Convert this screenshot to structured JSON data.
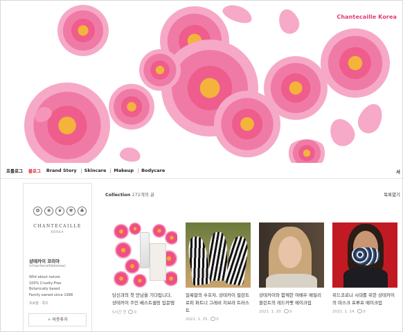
{
  "banner": {
    "brand_title": "Chantecaille Korea"
  },
  "nav": {
    "items": [
      {
        "label": "프롤로그",
        "active": false
      },
      {
        "label": "블로그",
        "active": true
      },
      {
        "label": "Brand Story",
        "active": false
      },
      {
        "label": "Skincare",
        "active": false
      },
      {
        "label": "Makeup",
        "active": false
      },
      {
        "label": "Bodycare",
        "active": false
      }
    ],
    "right_label": "서"
  },
  "profile": {
    "logo_text": "CHANTECAILLE",
    "logo_sub": "KOREA",
    "name": "샹테카이 코리아",
    "id": "(chantecaillekorea)",
    "desc": [
      "Wild about nature",
      "100% Cruelty-Free",
      "Botanically based",
      "Family owned since 1998"
    ],
    "meta": "프로필 · 쪽지",
    "neighbor_button": "이웃추가"
  },
  "collection": {
    "label": "Collection",
    "count": "272개의 글",
    "more": "목록열기"
  },
  "posts": [
    {
      "title": "당신과의 첫 만남을 기다립니다, 샹테카이 주인 베스트셀링 입문템",
      "date": "5시간 전",
      "comments": "0"
    },
    {
      "title": "얼룩말의 수호자, 샹테카이 필란트로피 파트너 그레비 지브라 트러스트",
      "date": "2021. 1. 25.",
      "comments": "0"
    },
    {
      "title": "샹테카이와 함께한 여배우 메릴리 블린트의 레드카펫 메이크업",
      "date": "2021. 1. 20.",
      "comments": "0"
    },
    {
      "title": "위드코로나 시대를 위한 샹테카이의 마스크 프루프 메이크업",
      "date": "2021. 1. 14.",
      "comments": "0"
    }
  ],
  "colors": {
    "accent": "#e2232f",
    "brand_pink": "#e03a76"
  }
}
